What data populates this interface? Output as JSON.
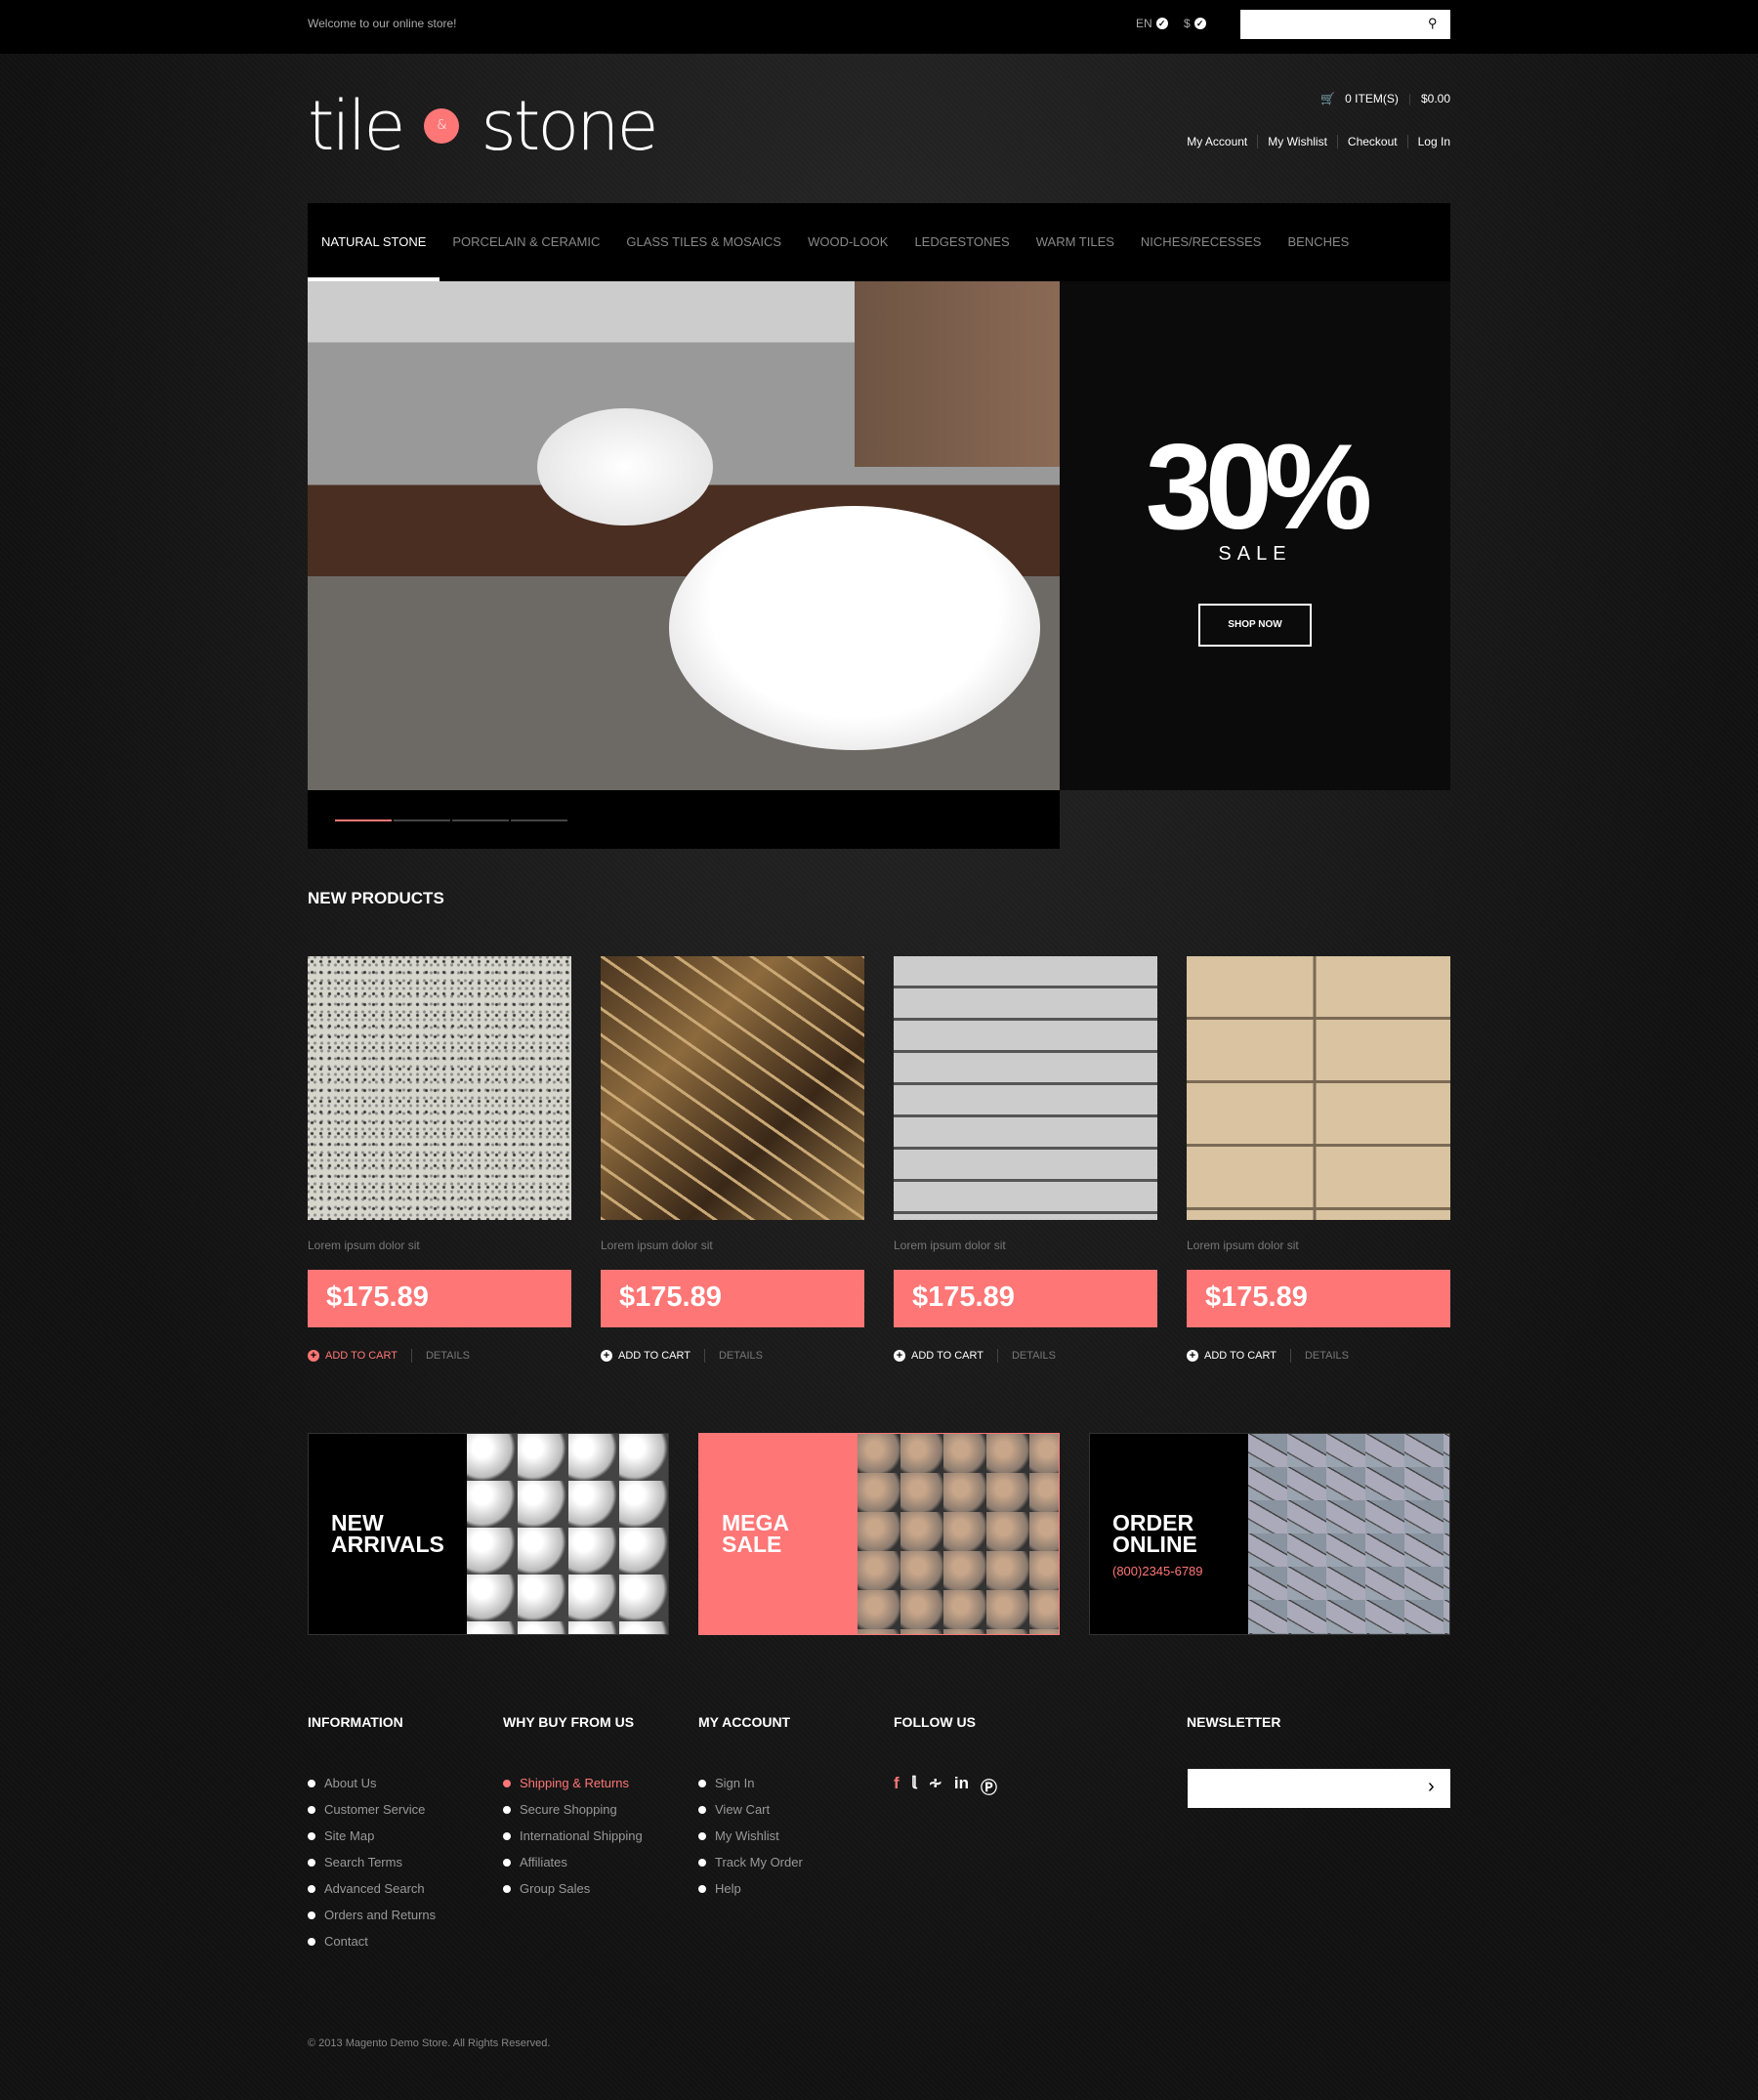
{
  "topbar": {
    "welcome": "Welcome to our online store!",
    "language": "EN",
    "currency": "$",
    "search_placeholder": ""
  },
  "logo": {
    "word1": "tile",
    "amp": "&",
    "word2": "stone"
  },
  "header": {
    "cart_items": "0 ITEM(S)",
    "cart_total": "$0.00",
    "links": [
      "My Account",
      "My Wishlist",
      "Checkout",
      "Log In"
    ]
  },
  "nav": [
    "NATURAL STONE",
    "PORCELAIN & CERAMIC",
    "GLASS TILES & MOSAICS",
    "WOOD-LOOK",
    "LEDGESTONES",
    "WARM TILES",
    "NICHES/RECESSES",
    "BENCHES"
  ],
  "slider": {
    "percent": "30%",
    "sale": "SALE",
    "button": "SHOP NOW",
    "slide_count": 4,
    "active_slide": 1
  },
  "products": {
    "title": "NEW PRODUCTS",
    "items": [
      {
        "name": "Lorem ipsum dolor sit",
        "price": "$175.89",
        "add": "ADD TO CART",
        "details": "DETAILS"
      },
      {
        "name": "Lorem ipsum dolor sit",
        "price": "$175.89",
        "add": "ADD TO CART",
        "details": "DETAILS"
      },
      {
        "name": "Lorem ipsum dolor sit",
        "price": "$175.89",
        "add": "ADD TO CART",
        "details": "DETAILS"
      },
      {
        "name": "Lorem ipsum dolor sit",
        "price": "$175.89",
        "add": "ADD TO CART",
        "details": "DETAILS"
      }
    ]
  },
  "banners": [
    {
      "l1": "NEW",
      "l2": "ARRIVALS"
    },
    {
      "l1": "MEGA",
      "l2": "SALE"
    },
    {
      "l1": "ORDER",
      "l2": "ONLINE",
      "phone": "(800)2345-6789"
    }
  ],
  "footer": {
    "information": {
      "title": "INFORMATION",
      "items": [
        "About Us",
        "Customer Service",
        "Site Map",
        "Search Terms",
        "Advanced Search",
        "Orders and Returns",
        "Contact"
      ]
    },
    "why": {
      "title": "WHY BUY FROM US",
      "items": [
        "Shipping & Returns",
        "Secure Shopping",
        "International Shipping",
        "Affiliates",
        "Group Sales"
      ]
    },
    "account": {
      "title": "MY ACCOUNT",
      "items": [
        "Sign In",
        "View Cart",
        "My Wishlist",
        "Track My Order",
        "Help"
      ]
    },
    "follow": {
      "title": "FOLLOW US",
      "icons": [
        "facebook-icon",
        "twitter-icon",
        "rss-icon",
        "linkedin-icon",
        "pinterest-icon"
      ]
    },
    "newsletter": {
      "title": "NEWSLETTER",
      "placeholder": ""
    },
    "copyright": "© 2013 Magento Demo Store. All Rights Reserved."
  },
  "colors": {
    "accent": "#ff7676",
    "background": "#151515"
  }
}
